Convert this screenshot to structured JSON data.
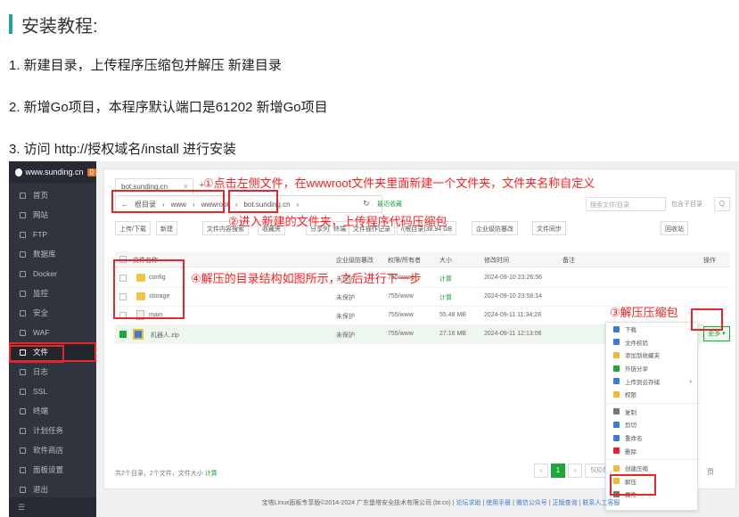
{
  "doc": {
    "title": "安装教程:",
    "steps": [
      "1. 新建目录，上传程序压缩包并解压 新建目录",
      "2. 新增Go项目，本程序默认端口是61202 新增Go项目",
      "3. 访问 http://授权域名/install 进行安装"
    ]
  },
  "screenshot": {
    "sidebar": {
      "site": "www.sunding.cn",
      "badge": "0",
      "items": [
        "首页",
        "网站",
        "FTP",
        "数据库",
        "Docker",
        "监控",
        "安全",
        "WAF",
        "文件",
        "日志",
        "SSL",
        "终端",
        "计划任务",
        "软件商店",
        "面板设置",
        "退出"
      ],
      "active_index": 8,
      "collapse": "☰"
    },
    "tab": {
      "label": "bot.sunding.cn",
      "close": "×",
      "add": "+"
    },
    "address": {
      "back": "←",
      "segments": [
        "根目录",
        "›",
        "www",
        "›",
        "wwwroot",
        "›",
        "bot.sunding.cn",
        "›"
      ],
      "reload": "↻",
      "recent": "最近收藏",
      "search_placeholder": "搜索文件/目录",
      "include_sub": "包含子目录",
      "search_btn": "Q"
    },
    "toolbar": [
      "上传/下载",
      "新建",
      "文件内容搜索",
      "收藏夹",
      "分享列表",
      "终端",
      "文件操作记录",
      "/(根目录)38.94 GB",
      "企业级防篡改",
      "文件同步",
      "回收站"
    ],
    "table": {
      "headers": [
        "文件名称",
        "权限/所有者",
        "大小",
        "修改时间",
        "备注",
        "操作",
        "企业级防篡改"
      ],
      "rows": [
        {
          "name": "config",
          "protect": "未保护",
          "perm": "755/www",
          "size": "计算",
          "time": "2024-09-10 23:26:56"
        },
        {
          "name": "storage",
          "protect": "未保护",
          "perm": "755/www",
          "size": "计算",
          "time": "2024-09-10 23:58:14"
        },
        {
          "name": "main",
          "protect": "未保护",
          "perm": "755/www",
          "size": "55.48 MB",
          "time": "2024-09-11 11:34:28"
        },
        {
          "name": "机器人.zip",
          "protect": "未保护",
          "perm": "755/www",
          "size": "27.16 MB",
          "time": "2024-09-11 12:13:06",
          "more": "更多 ▾"
        }
      ]
    },
    "footer_info": "共2个目录，2个文件，文件大小",
    "footer_calc": "计算",
    "pager": {
      "prev": "‹",
      "page": "1",
      "next": "›",
      "size": "500条",
      "ye": "页"
    },
    "context_menu": [
      "下载",
      "文件校验",
      "添加到收藏夹",
      "外链分享",
      "上传到云存储",
      "权限",
      "复制",
      "剪切",
      "重命名",
      "删除",
      "创建压缩",
      "解压",
      "属性"
    ],
    "panel_footer": {
      "copyright": "宝塔Linux面板专享版©2014-2024 广东堡塔安全技术有限公司 (bt.cn)",
      "links": [
        "论坛求助",
        "使用手册",
        "微信公众号",
        "正版查询",
        "联系人工客服"
      ]
    }
  },
  "annotations": {
    "n1": "①点击左侧文件，在wwwroot文件夹里面新建一个文件夹，文件夹名称自定义",
    "n2": "②进入新建的文件夹，上传程序代码压缩包",
    "n3": "③解压压缩包",
    "n4": "④解压的目录结构如图所示，之后进行下一步"
  },
  "colors": {
    "accent": "#20a53a",
    "annotation_red": "#ff1c1c",
    "sidebar": "#30343e",
    "title_bar": "#20a0a0"
  }
}
